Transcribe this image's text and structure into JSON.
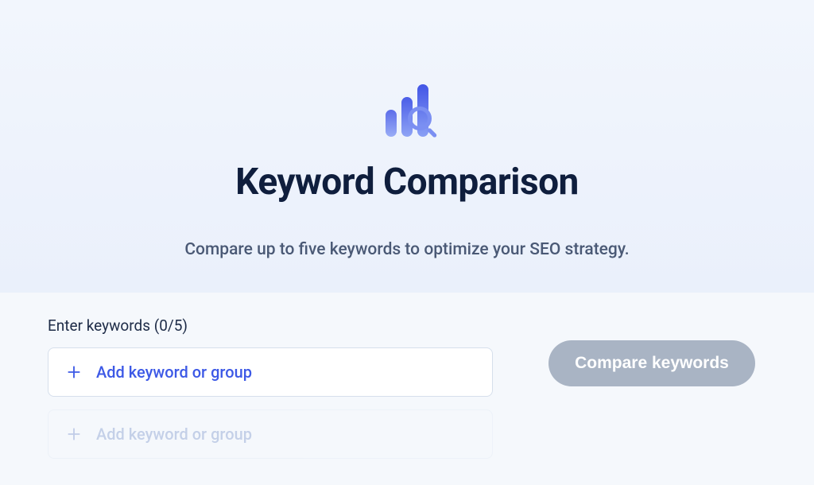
{
  "hero": {
    "title": "Keyword Comparison",
    "subtitle": "Compare up to five keywords to optimize your SEO strategy."
  },
  "form": {
    "section_label": "Enter keywords (0/5)",
    "row_active_label": "Add keyword or group",
    "row_inactive_label": "Add keyword or group",
    "compare_button": "Compare keywords"
  }
}
